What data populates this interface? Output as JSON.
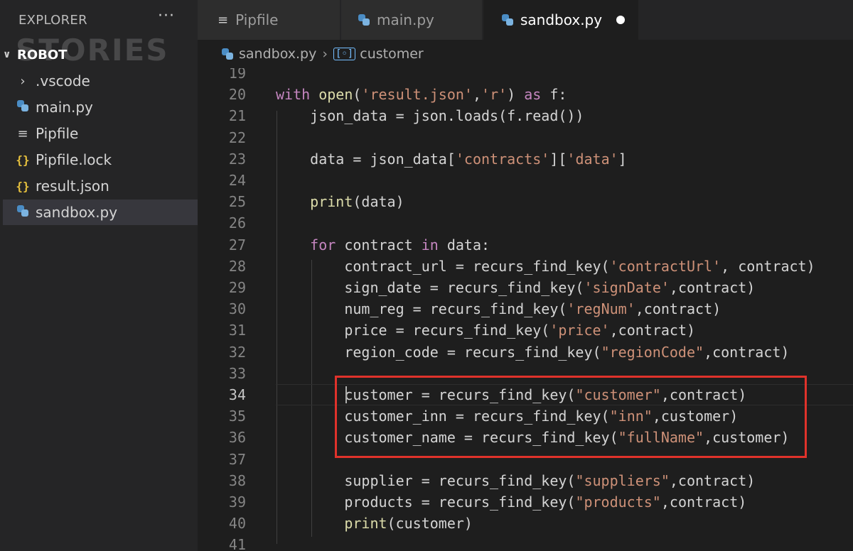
{
  "sidebar": {
    "header": "EXPLORER",
    "more": "···",
    "watermark": "STORIES",
    "project": "ROBOT",
    "items": [
      {
        "label": ".vscode",
        "icon": "chevron-right-icon"
      },
      {
        "label": "main.py",
        "icon": "python-icon"
      },
      {
        "label": "Pipfile",
        "icon": "file-lines-icon"
      },
      {
        "label": "Pipfile.lock",
        "icon": "json-braces-icon"
      },
      {
        "label": "result.json",
        "icon": "json-braces-icon"
      },
      {
        "label": "sandbox.py",
        "icon": "python-icon",
        "active": true
      }
    ]
  },
  "tabs": [
    {
      "label": "Pipfile",
      "icon": "file-lines-icon",
      "active": false
    },
    {
      "label": "main.py",
      "icon": "python-icon",
      "active": false
    },
    {
      "label": "sandbox.py",
      "icon": "python-icon",
      "active": true,
      "dirty": true
    }
  ],
  "breadcrumb": {
    "file": "sandbox.py",
    "symbol": "customer"
  },
  "editor": {
    "lines": [
      {
        "n": "19",
        "tokens": []
      },
      {
        "n": "20",
        "tokens": [
          [
            "kw",
            "with "
          ],
          [
            "fn",
            "open"
          ],
          [
            "plain",
            "("
          ],
          [
            "str",
            "'result.json'"
          ],
          [
            "plain",
            ","
          ],
          [
            "str",
            "'r'"
          ],
          [
            "plain",
            ") "
          ],
          [
            "kw",
            "as"
          ],
          [
            "plain",
            " f:"
          ]
        ]
      },
      {
        "n": "21",
        "tokens": [
          [
            "plain",
            "    json_data = json.loads(f.read())"
          ]
        ]
      },
      {
        "n": "22",
        "tokens": []
      },
      {
        "n": "23",
        "tokens": [
          [
            "plain",
            "    data = json_data["
          ],
          [
            "str",
            "'contracts'"
          ],
          [
            "plain",
            "]["
          ],
          [
            "str",
            "'data'"
          ],
          [
            "plain",
            "]"
          ]
        ]
      },
      {
        "n": "24",
        "tokens": []
      },
      {
        "n": "25",
        "tokens": [
          [
            "fn",
            "    print"
          ],
          [
            "plain",
            "(data)"
          ]
        ]
      },
      {
        "n": "26",
        "tokens": []
      },
      {
        "n": "27",
        "tokens": [
          [
            "kw",
            "    for"
          ],
          [
            "plain",
            " contract "
          ],
          [
            "kw",
            "in"
          ],
          [
            "plain",
            " data:"
          ]
        ]
      },
      {
        "n": "28",
        "tokens": [
          [
            "plain",
            "        contract_url = recurs_find_key("
          ],
          [
            "str",
            "'contractUrl'"
          ],
          [
            "plain",
            ", contract)"
          ]
        ]
      },
      {
        "n": "29",
        "tokens": [
          [
            "plain",
            "        sign_date = recurs_find_key("
          ],
          [
            "str",
            "'signDate'"
          ],
          [
            "plain",
            ",contract)"
          ]
        ]
      },
      {
        "n": "30",
        "tokens": [
          [
            "plain",
            "        num_reg = recurs_find_key("
          ],
          [
            "str",
            "'regNum'"
          ],
          [
            "plain",
            ",contract)"
          ]
        ]
      },
      {
        "n": "31",
        "tokens": [
          [
            "plain",
            "        price = recurs_find_key("
          ],
          [
            "str",
            "'price'"
          ],
          [
            "plain",
            ",contract)"
          ]
        ]
      },
      {
        "n": "32",
        "tokens": [
          [
            "plain",
            "        region_code = recurs_find_key("
          ],
          [
            "str",
            "\"regionCode\""
          ],
          [
            "plain",
            ",contract)"
          ]
        ]
      },
      {
        "n": "33",
        "tokens": []
      },
      {
        "n": "34",
        "tokens": [
          [
            "plain",
            "        customer = recurs_find_key("
          ],
          [
            "str",
            "\"customer\""
          ],
          [
            "plain",
            ",contract)"
          ]
        ],
        "current": true
      },
      {
        "n": "35",
        "tokens": [
          [
            "plain",
            "        customer_inn = recurs_find_key("
          ],
          [
            "str",
            "\"inn\""
          ],
          [
            "plain",
            ",customer)"
          ]
        ]
      },
      {
        "n": "36",
        "tokens": [
          [
            "plain",
            "        customer_name = recurs_find_key("
          ],
          [
            "str",
            "\"fullName\""
          ],
          [
            "plain",
            ",customer)"
          ]
        ]
      },
      {
        "n": "37",
        "tokens": []
      },
      {
        "n": "38",
        "tokens": [
          [
            "plain",
            "        supplier = recurs_find_key("
          ],
          [
            "str",
            "\"suppliers\""
          ],
          [
            "plain",
            ",contract)"
          ]
        ]
      },
      {
        "n": "39",
        "tokens": [
          [
            "plain",
            "        products = recurs_find_key("
          ],
          [
            "str",
            "\"products\""
          ],
          [
            "plain",
            ",contract)"
          ]
        ]
      },
      {
        "n": "40",
        "tokens": [
          [
            "fn",
            "        print"
          ],
          [
            "plain",
            "(customer)"
          ]
        ]
      },
      {
        "n": "41",
        "tokens": []
      }
    ]
  },
  "colors": {
    "highlight_box": "#e0322b",
    "keyword": "#c586c0",
    "function": "#dcdcaa",
    "string": "#ce9178"
  }
}
